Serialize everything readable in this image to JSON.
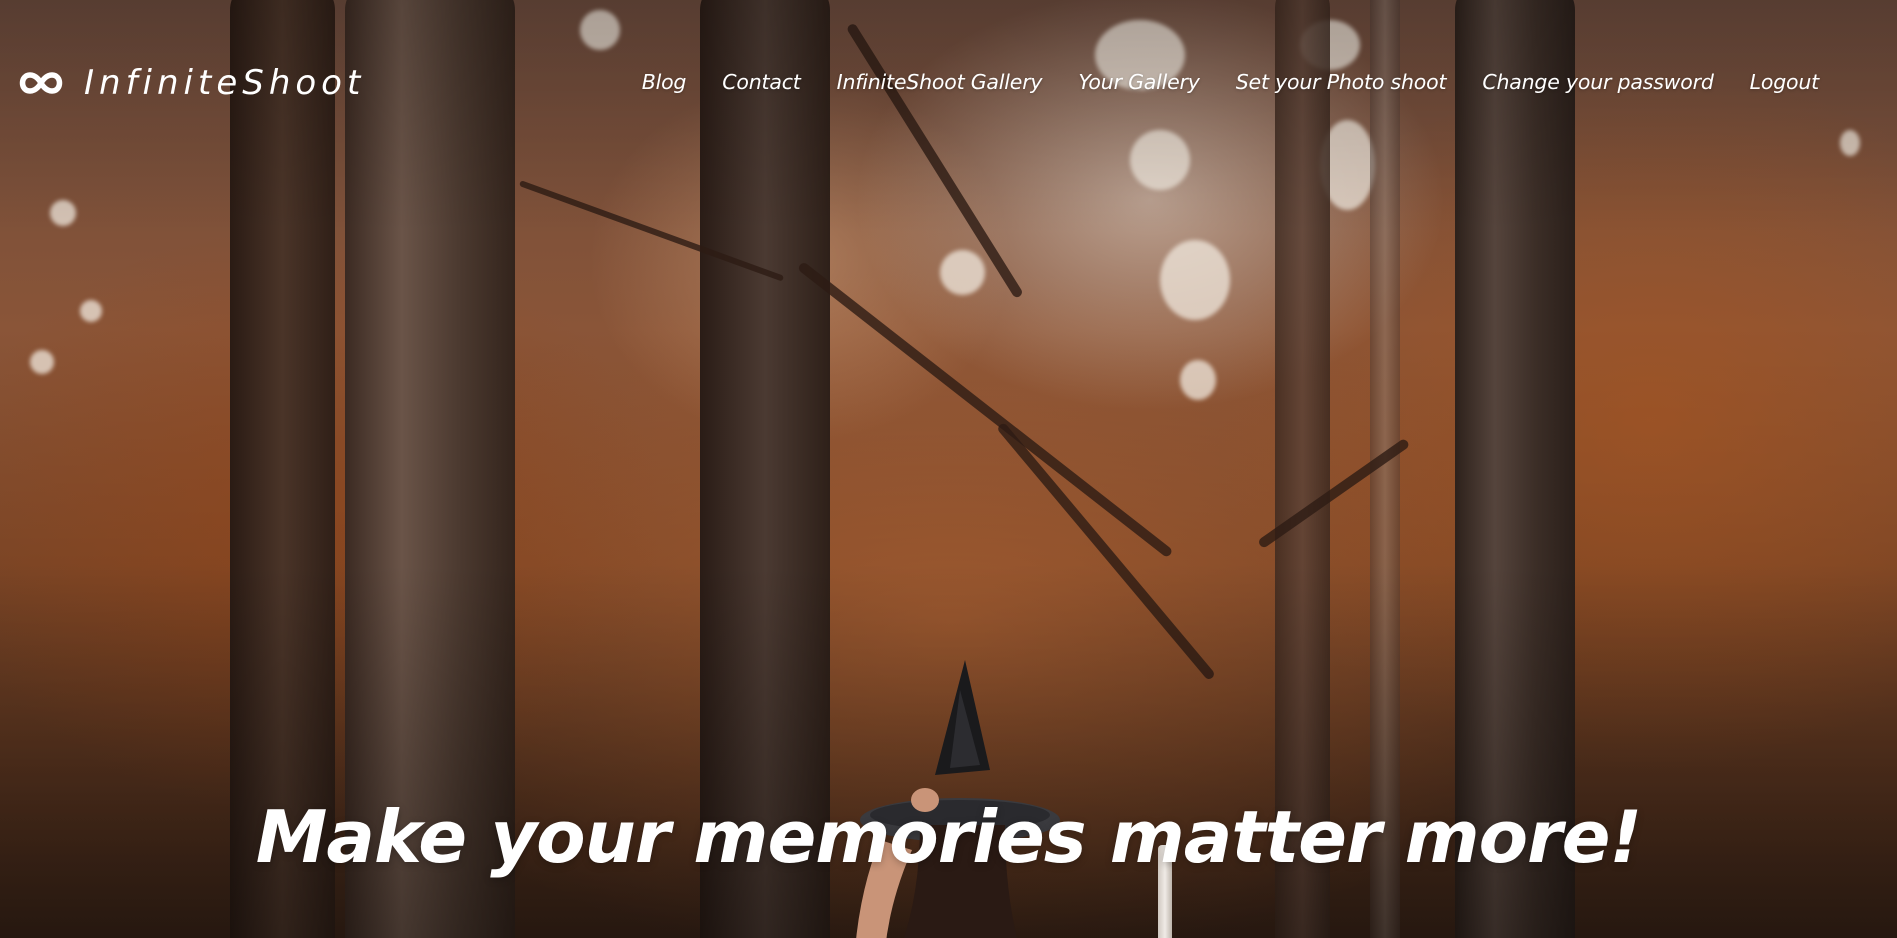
{
  "header": {
    "logo": {
      "icon": "infinity-icon",
      "text": "InfiniteShoot"
    },
    "nav": [
      {
        "label": "Blog",
        "name": "nav-blog"
      },
      {
        "label": "Contact",
        "name": "nav-contact"
      },
      {
        "label": "InfiniteShoot Gallery",
        "name": "nav-infiniteshoot-gallery"
      },
      {
        "label": "Your Gallery",
        "name": "nav-your-gallery"
      },
      {
        "label": "Set your Photo shoot",
        "name": "nav-set-photo-shoot"
      },
      {
        "label": "Change your password",
        "name": "nav-change-password"
      },
      {
        "label": "Logout",
        "name": "nav-logout"
      }
    ]
  },
  "hero": {
    "background": "autumn-forest-witch-photo",
    "tagline": "Make your memories matter more!"
  },
  "colors": {
    "text": "#ffffff",
    "autumn_orange": "#b0602a",
    "bark_dark": "#2e1e16"
  }
}
